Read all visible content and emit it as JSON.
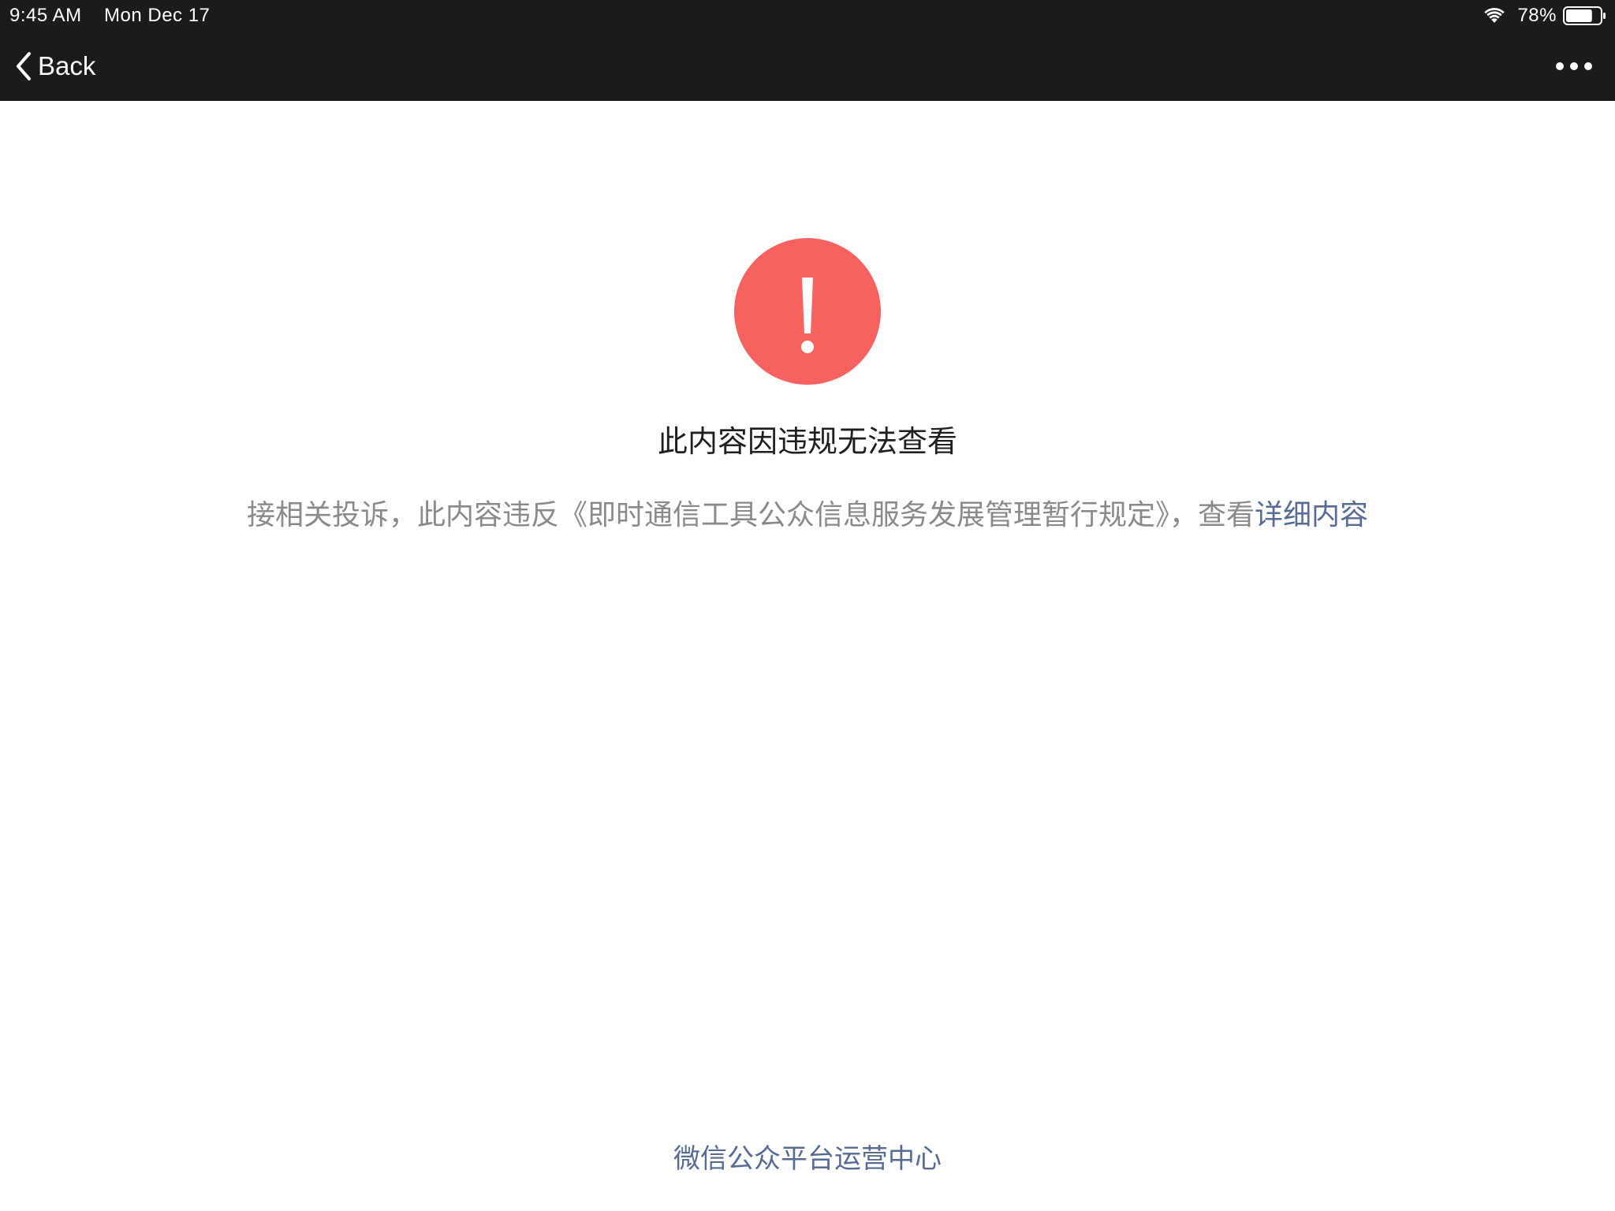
{
  "status_bar": {
    "time": "9:45 AM",
    "date": "Mon Dec 17",
    "battery_percent": "78%",
    "battery_level": 0.78
  },
  "nav": {
    "back_label": "Back",
    "more_icon": "more-horizontal-icon"
  },
  "content": {
    "icon": "exclamation-circle-icon",
    "title": "此内容因违规无法查看",
    "description_prefix": "接相关投诉，此内容违反《即时通信工具公众信息服务发展管理暂行规定》，查看",
    "detail_link": "详细内容"
  },
  "footer": {
    "text": "微信公众平台运营中心"
  },
  "colors": {
    "bar_background": "#1b1b1e",
    "warning_red": "#f76260",
    "link_blue": "#576b95",
    "description_gray": "#8a8a8a"
  }
}
